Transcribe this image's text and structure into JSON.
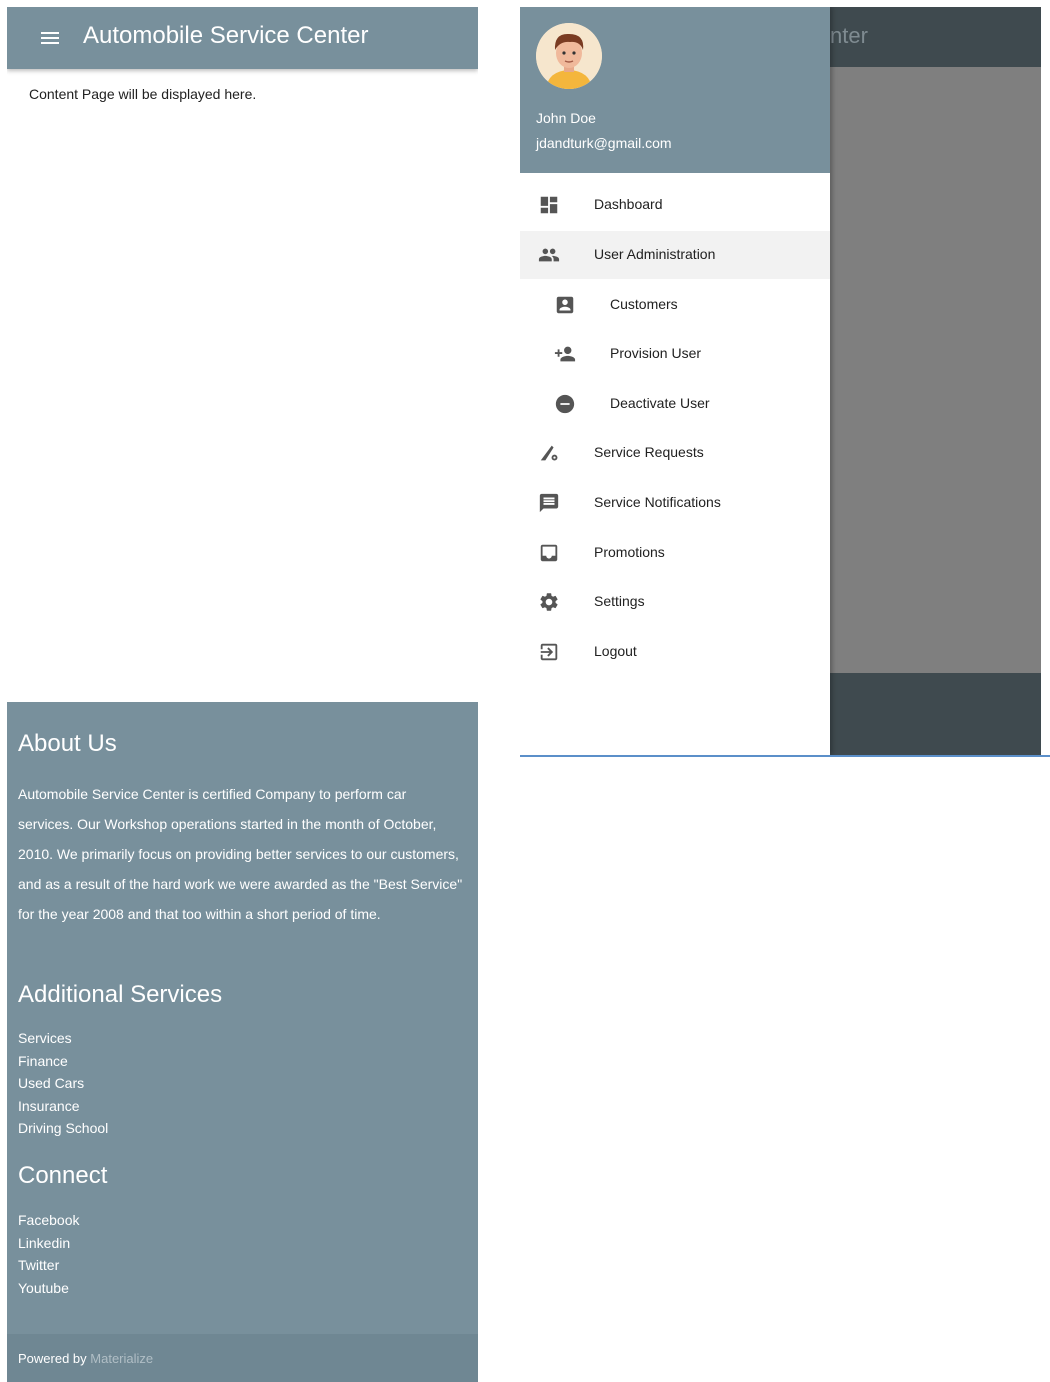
{
  "left_screen": {
    "header": {
      "menu_icon": "hamburger-menu-icon",
      "title": "Automobile Service Center"
    },
    "content": {
      "text": "Content Page will be displayed here."
    },
    "footer": {
      "about": {
        "heading": "About Us",
        "text": "Automobile Service Center is certified Company to perform car services. Our Workshop operations started in the month of October, 2010. We primarily focus on providing better services to our customers, and as a result of the hard work we were awarded as the \"Best Service\" for the year 2008 and that too within a short period of time."
      },
      "additional_services": {
        "heading": "Additional Services",
        "links": [
          "Services",
          "Finance",
          "Used Cars",
          "Insurance",
          "Driving School"
        ]
      },
      "connect": {
        "heading": "Connect",
        "links": [
          "Facebook",
          "Linkedin",
          "Twitter",
          "Youtube"
        ]
      },
      "copyright": {
        "prefix": "Powered by",
        "link": "Materialize"
      }
    }
  },
  "right_screen": {
    "background_title_fragment": "nter",
    "user": {
      "name": "John Doe",
      "email": "jdandturk@gmail.com",
      "avatar_icon": "user-avatar-icon"
    },
    "menu": [
      {
        "label": "Dashboard",
        "icon": "dashboard-icon"
      },
      {
        "label": "User Administration",
        "icon": "people-icon"
      },
      {
        "label": "Customers",
        "icon": "account-box-icon"
      },
      {
        "label": "Provision User",
        "icon": "person-add-icon"
      },
      {
        "label": "Deactivate User",
        "icon": "remove-circle-icon"
      },
      {
        "label": "Service Requests",
        "icon": "build-gear-icon"
      },
      {
        "label": "Service Notifications",
        "icon": "message-icon"
      },
      {
        "label": "Promotions",
        "icon": "inbox-icon"
      },
      {
        "label": "Settings",
        "icon": "settings-gear-icon"
      },
      {
        "label": "Logout",
        "icon": "exit-icon"
      }
    ]
  },
  "colors": {
    "primary": "#78909c",
    "dark_overlay_bar": "#3f4a4f",
    "overlay": "#7f7f7f",
    "active_item_bg": "#f2f2f2",
    "link_muted": "#b0bec5"
  }
}
